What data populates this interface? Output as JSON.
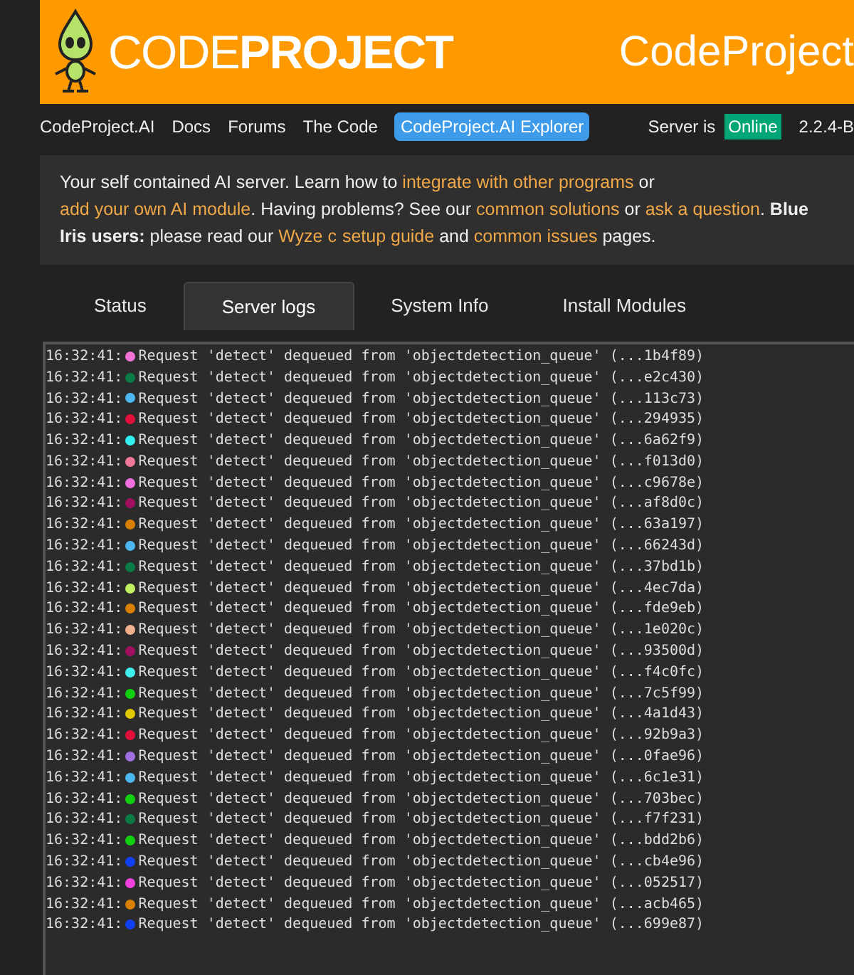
{
  "header": {
    "wordmark": "CODE**PROJECT**",
    "title_right": "CodeProject"
  },
  "nav": {
    "items": [
      {
        "label": "CodeProject.AI",
        "kind": "link"
      },
      {
        "label": "Docs",
        "kind": "link"
      },
      {
        "label": "Forums",
        "kind": "link"
      },
      {
        "label": "The Code",
        "kind": "link"
      },
      {
        "label": "CodeProject.AI Explorer",
        "kind": "button"
      }
    ],
    "server_label": "Server is",
    "server_status": "Online",
    "version": "2.2.4-B"
  },
  "info": {
    "segments": [
      {
        "kind": "text",
        "text": "Your self contained AI server. Learn how to "
      },
      {
        "kind": "link",
        "text": "integrate with other programs"
      },
      {
        "kind": "text",
        "text": " or "
      },
      {
        "kind": "link",
        "text": "add your own AI module"
      },
      {
        "kind": "text",
        "text": ". Having problems? See our "
      },
      {
        "kind": "link",
        "text": "common solutions"
      },
      {
        "kind": "text",
        "text": " or "
      },
      {
        "kind": "link",
        "text": "ask a question"
      },
      {
        "kind": "text",
        "text": ". **Blue Iris users:** please read our "
      },
      {
        "kind": "link",
        "text": "Wyze c"
      },
      {
        "kind": "link",
        "text": "setup guide"
      },
      {
        "kind": "text",
        "text": " and "
      },
      {
        "kind": "link",
        "text": "common issues"
      },
      {
        "kind": "text",
        "text": " pages."
      }
    ]
  },
  "tabs": [
    {
      "label": "Status",
      "selected": false
    },
    {
      "label": "Server logs",
      "selected": true
    },
    {
      "label": "System Info",
      "selected": false
    },
    {
      "label": "Install Modules",
      "selected": false
    }
  ],
  "logs": [
    {
      "time": "16:32:41:",
      "color": "#f472d8",
      "message": "Request 'detect' dequeued from 'objectdetection_queue' (...1b4f89)"
    },
    {
      "time": "16:32:41:",
      "color": "#0b7a45",
      "message": "Request 'detect' dequeued from 'objectdetection_queue' (...e2c430)"
    },
    {
      "time": "16:32:41:",
      "color": "#4db8f0",
      "message": "Request 'detect' dequeued from 'objectdetection_queue' (...113c73)"
    },
    {
      "time": "16:32:41:",
      "color": "#e0103a",
      "message": "Request 'detect' dequeued from 'objectdetection_queue' (...294935)"
    },
    {
      "time": "16:32:41:",
      "color": "#33f0f0",
      "message": "Request 'detect' dequeued from 'objectdetection_queue' (...6a62f9)"
    },
    {
      "time": "16:32:41:",
      "color": "#f07898",
      "message": "Request 'detect' dequeued from 'objectdetection_queue' (...f013d0)"
    },
    {
      "time": "16:32:41:",
      "color": "#f070e0",
      "message": "Request 'detect' dequeued from 'objectdetection_queue' (...c9678e)"
    },
    {
      "time": "16:32:41:",
      "color": "#a01060",
      "message": "Request 'detect' dequeued from 'objectdetection_queue' (...af8d0c)"
    },
    {
      "time": "16:32:41:",
      "color": "#d98000",
      "message": "Request 'detect' dequeued from 'objectdetection_queue' (...63a197)"
    },
    {
      "time": "16:32:41:",
      "color": "#4db8f0",
      "message": "Request 'detect' dequeued from 'objectdetection_queue' (...66243d)"
    },
    {
      "time": "16:32:41:",
      "color": "#0b7a45",
      "message": "Request 'detect' dequeued from 'objectdetection_queue' (...37bd1b)"
    },
    {
      "time": "16:32:41:",
      "color": "#c0f060",
      "message": "Request 'detect' dequeued from 'objectdetection_queue' (...4ec7da)"
    },
    {
      "time": "16:32:41:",
      "color": "#d98000",
      "message": "Request 'detect' dequeued from 'objectdetection_queue' (...fde9eb)"
    },
    {
      "time": "16:32:41:",
      "color": "#f0b090",
      "message": "Request 'detect' dequeued from 'objectdetection_queue' (...1e020c)"
    },
    {
      "time": "16:32:41:",
      "color": "#a01060",
      "message": "Request 'detect' dequeued from 'objectdetection_queue' (...93500d)"
    },
    {
      "time": "16:32:41:",
      "color": "#40f0f0",
      "message": "Request 'detect' dequeued from 'objectdetection_queue' (...f4c0fc)"
    },
    {
      "time": "16:32:41:",
      "color": "#10d010",
      "message": "Request 'detect' dequeued from 'objectdetection_queue' (...7c5f99)"
    },
    {
      "time": "16:32:41:",
      "color": "#e0c800",
      "message": "Request 'detect' dequeued from 'objectdetection_queue' (...4a1d43)"
    },
    {
      "time": "16:32:41:",
      "color": "#e0103a",
      "message": "Request 'detect' dequeued from 'objectdetection_queue' (...92b9a3)"
    },
    {
      "time": "16:32:41:",
      "color": "#a070e0",
      "message": "Request 'detect' dequeued from 'objectdetection_queue' (...0fae96)"
    },
    {
      "time": "16:32:41:",
      "color": "#4db8f0",
      "message": "Request 'detect' dequeued from 'objectdetection_queue' (...6c1e31)"
    },
    {
      "time": "16:32:41:",
      "color": "#10d010",
      "message": "Request 'detect' dequeued from 'objectdetection_queue' (...703bec)"
    },
    {
      "time": "16:32:41:",
      "color": "#0b7a45",
      "message": "Request 'detect' dequeued from 'objectdetection_queue' (...f7f231)"
    },
    {
      "time": "16:32:41:",
      "color": "#10d010",
      "message": "Request 'detect' dequeued from 'objectdetection_queue' (...bdd2b6)"
    },
    {
      "time": "16:32:41:",
      "color": "#1040f0",
      "message": "Request 'detect' dequeued from 'objectdetection_queue' (...cb4e96)"
    },
    {
      "time": "16:32:41:",
      "color": "#f040e0",
      "message": "Request 'detect' dequeued from 'objectdetection_queue' (...052517)"
    },
    {
      "time": "16:32:41:",
      "color": "#d98000",
      "message": "Request 'detect' dequeued from 'objectdetection_queue' (...acb465)"
    },
    {
      "time": "16:32:41:",
      "color": "#1040f0",
      "message": "Request 'detect' dequeued from 'objectdetection_queue' (...699e87)"
    }
  ]
}
